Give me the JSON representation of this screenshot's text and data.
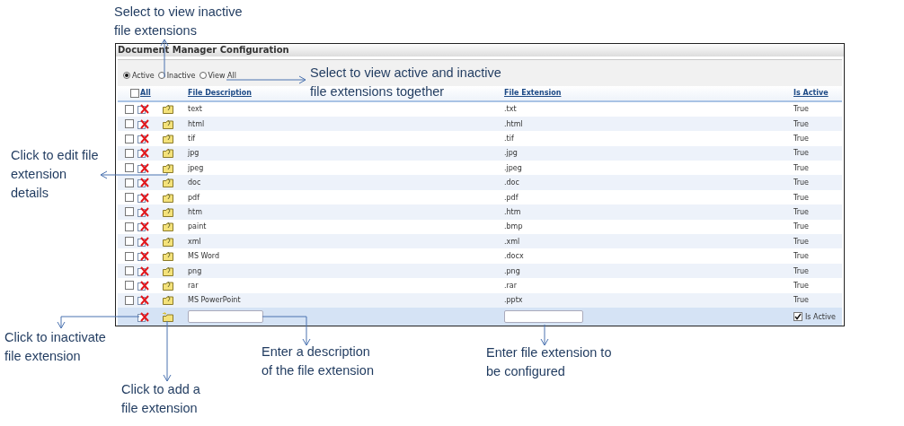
{
  "panel": {
    "title": "Document Manager Configuration",
    "filters": [
      {
        "label": "Active",
        "selected": true
      },
      {
        "label": "Inactive",
        "selected": false
      },
      {
        "label": "View All",
        "selected": false
      }
    ],
    "select_all": {
      "label": "All",
      "checked": false
    },
    "columns": [
      "File Description",
      "File Extension",
      "Is Active"
    ],
    "rows": [
      {
        "description": "text",
        "extension": ".txt",
        "is_active": "True",
        "checked": false
      },
      {
        "description": "html",
        "extension": ".html",
        "is_active": "True",
        "checked": false
      },
      {
        "description": "tif",
        "extension": ".tif",
        "is_active": "True",
        "checked": false
      },
      {
        "description": "jpg",
        "extension": ".jpg",
        "is_active": "True",
        "checked": false
      },
      {
        "description": "jpeg",
        "extension": ".jpeg",
        "is_active": "True",
        "checked": false
      },
      {
        "description": "doc",
        "extension": ".doc",
        "is_active": "True",
        "checked": false
      },
      {
        "description": "pdf",
        "extension": ".pdf",
        "is_active": "True",
        "checked": false
      },
      {
        "description": "htm",
        "extension": ".htm",
        "is_active": "True",
        "checked": false
      },
      {
        "description": "paint",
        "extension": ".bmp",
        "is_active": "True",
        "checked": false
      },
      {
        "description": "xml",
        "extension": ".xml",
        "is_active": "True",
        "checked": false
      },
      {
        "description": "MS Word",
        "extension": ".docx",
        "is_active": "True",
        "checked": false
      },
      {
        "description": "png",
        "extension": ".png",
        "is_active": "True",
        "checked": false
      },
      {
        "description": "rar",
        "extension": ".rar",
        "is_active": "True",
        "checked": false
      },
      {
        "description": "MS PowerPoint",
        "extension": ".pptx",
        "is_active": "True",
        "checked": false
      }
    ],
    "new_row": {
      "is_active_label": "Is Active",
      "is_active_checked": true
    }
  },
  "annotations": [
    {
      "text": "Select to view inactive\nfile extensions"
    },
    {
      "text": "Select to view active and inactive\nfile extensions together"
    },
    {
      "text": "Click to edit file\nextension\ndetails"
    },
    {
      "text": "Click to inactivate\nfile extension"
    },
    {
      "text": "Click to add a\nfile extension"
    },
    {
      "text": "Enter a description\nof the file extension"
    },
    {
      "text": "Enter file extension to\nbe configured"
    }
  ]
}
